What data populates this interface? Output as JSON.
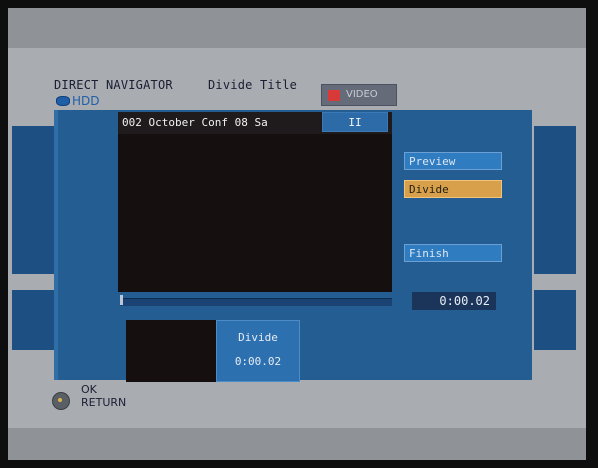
{
  "header": {
    "app_name": "DIRECT NAVIGATOR",
    "mode_title": "Divide Title",
    "drive_label": "HDD",
    "video_tab_label": "VIDEO"
  },
  "player": {
    "title_text": "002 October Conf 08 Sa",
    "status_symbol": "II",
    "position_text": "0:00.02"
  },
  "menu": {
    "preview_label": "Preview",
    "divide_label": "Divide",
    "finish_label": "Finish"
  },
  "divide_point": {
    "label": "Divide",
    "time": "0:00.02"
  },
  "footer": {
    "ok_label": "OK",
    "return_label": "RETURN"
  }
}
